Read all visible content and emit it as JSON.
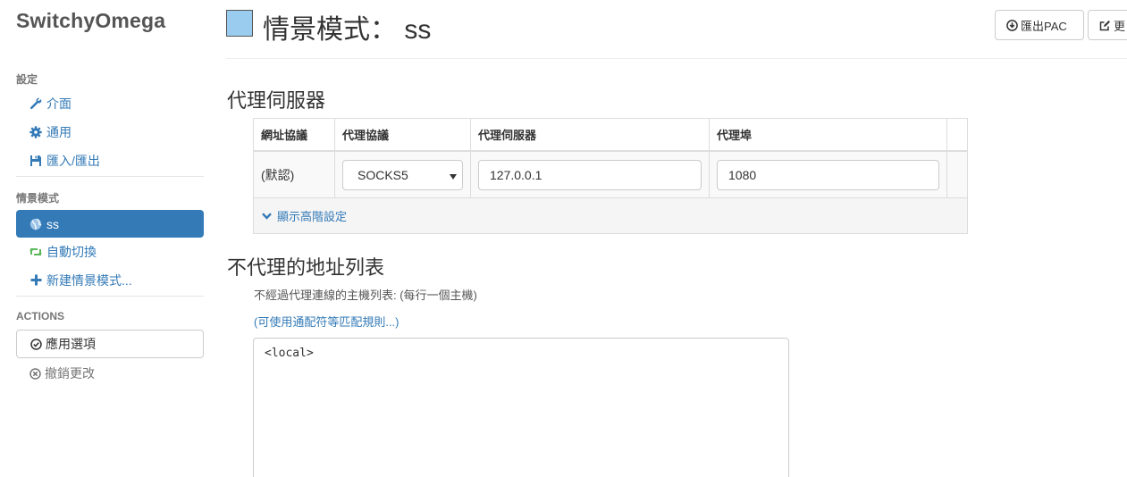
{
  "sidebar": {
    "brand": "SwitchyOmega",
    "settings_header": "設定",
    "settings_items": [
      {
        "label": "介面",
        "icon": "wrench-icon"
      },
      {
        "label": "通用",
        "icon": "gear-icon"
      },
      {
        "label": "匯入/匯出",
        "icon": "floppy-icon"
      }
    ],
    "profiles_header": "情景模式",
    "profile_items": [
      {
        "label": "ss",
        "icon": "globe-icon",
        "active": true
      },
      {
        "label": "自動切換",
        "icon": "retweet-icon"
      },
      {
        "label": "新建情景模式...",
        "icon": "plus-icon"
      }
    ],
    "actions_header": "ACTIONS",
    "apply_label": "應用選項",
    "discard_label": "撤銷更改"
  },
  "header": {
    "title": "情景模式： ss",
    "profile_color": "#99ccee",
    "export_pac_label": "匯出PAC",
    "edit_label": "更"
  },
  "proxy": {
    "section_title": "代理伺服器",
    "columns": [
      "網址協議",
      "代理協議",
      "代理伺服器",
      "代理埠"
    ],
    "row": {
      "scheme": "(默認)",
      "protocol": "SOCKS5",
      "server": "127.0.0.1",
      "port": "1080"
    },
    "advanced_label": "顯示高階設定"
  },
  "bypass": {
    "section_title": "不代理的地址列表",
    "help_text": "不經過代理連線的主機列表: (每行一個主機)",
    "wildcard_link": "(可使用通配符等匹配規則...)",
    "content": "<local>"
  },
  "colors": {
    "accent": "#337ab7",
    "green_icon": "#5cb85c"
  }
}
